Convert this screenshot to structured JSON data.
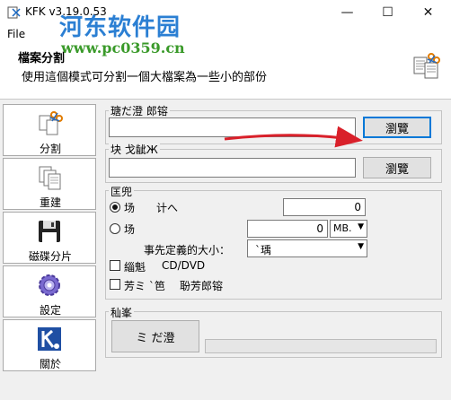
{
  "window": {
    "title": "KFK v3.19.0.53",
    "controls": {
      "minimize": "—",
      "maximize": "☐",
      "close": "✕"
    }
  },
  "menu": {
    "file": "File"
  },
  "watermark": {
    "site_name": "河东软件园",
    "url": "www.pc0359.cn"
  },
  "header": {
    "title": "檔案分割",
    "description": "使用這個模式可分割一個大檔案為一些小的部份"
  },
  "nav": {
    "items": [
      {
        "label": "分割",
        "icon": "scissors-icon"
      },
      {
        "label": "重建",
        "icon": "documents-icon"
      },
      {
        "label": "磁碟分片",
        "icon": "floppy-disk-icon"
      },
      {
        "label": "設定",
        "icon": "gear-icon"
      },
      {
        "label": "關於",
        "icon": "kfk-logo-icon"
      }
    ]
  },
  "source": {
    "group_label": "瑭だ澄  郎镕",
    "value": "",
    "browse_label": "瀏覽"
  },
  "output": {
    "group_label": "块  戈龇Ж",
    "value": "",
    "browse_label": "瀏覽"
  },
  "options": {
    "group_label": "匡兜",
    "radio1_label": "场",
    "radio1_suffix": "计へ",
    "count_value": "0",
    "radio2_label": "场",
    "size_value": "0",
    "unit_value": "MB.",
    "preset_label": "事先定義的大小：",
    "preset_value": "`瑀",
    "cd_check_label": "緇魁",
    "cd_check_suffix": "CD/DVD",
    "batch_check_label": "芳ミ `笆",
    "batch_check_suffix": "聁芳郎镕"
  },
  "execute": {
    "group_label": "秈峯",
    "button_label": "ミ だ澄",
    "progress_percent": 0
  },
  "colors": {
    "arrow": "#d9202a",
    "watermark_blue": "#2b7fd3",
    "watermark_green": "#3a9a2a"
  }
}
